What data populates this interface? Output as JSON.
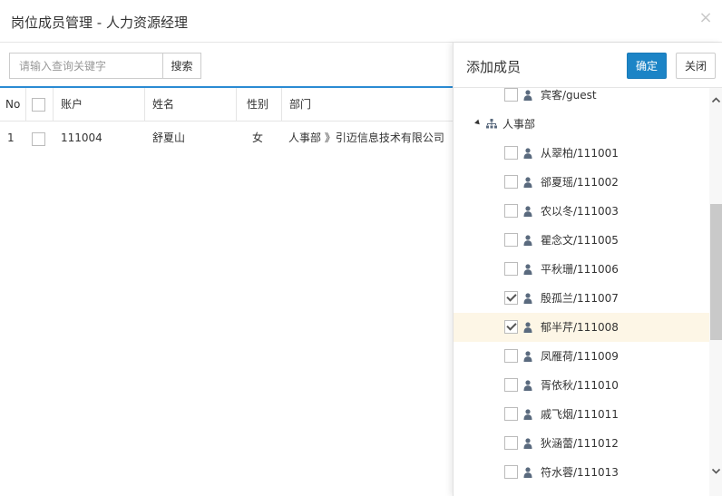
{
  "dialog": {
    "title": "岗位成员管理 - 人力资源经理",
    "close_glyph": "×"
  },
  "search": {
    "placeholder": "请输入查询关键字",
    "button_label": "搜索"
  },
  "table": {
    "columns": [
      "No",
      "",
      "账户",
      "姓名",
      "性别",
      "部门"
    ],
    "rows": [
      {
        "no": "1",
        "checked": false,
        "account": "111004",
        "name": "舒夏山",
        "gender": "女",
        "department": "人事部 》引迈信息技术有限公司"
      }
    ]
  },
  "add_panel": {
    "title": "添加成员",
    "confirm_label": "确定",
    "close_label": "关闭",
    "tree": [
      {
        "type": "user",
        "label": "宾客/guest",
        "checked": false
      },
      {
        "type": "dept",
        "label": "人事部",
        "expanded": true
      },
      {
        "type": "user",
        "label": "从翠柏/111001",
        "checked": false
      },
      {
        "type": "user",
        "label": "郤夏瑶/111002",
        "checked": false
      },
      {
        "type": "user",
        "label": "农以冬/111003",
        "checked": false
      },
      {
        "type": "user",
        "label": "瞿念文/111005",
        "checked": false
      },
      {
        "type": "user",
        "label": "平秋珊/111006",
        "checked": false
      },
      {
        "type": "user",
        "label": "殷孤兰/111007",
        "checked": true
      },
      {
        "type": "user",
        "label": "郁半芹/111008",
        "checked": true,
        "highlighted": true
      },
      {
        "type": "user",
        "label": "凤雁荷/111009",
        "checked": false
      },
      {
        "type": "user",
        "label": "胥依秋/111010",
        "checked": false
      },
      {
        "type": "user",
        "label": "戚飞烟/111011",
        "checked": false
      },
      {
        "type": "user",
        "label": "狄涵蕾/111012",
        "checked": false
      },
      {
        "type": "user",
        "label": "符水蓉/111013",
        "checked": false
      }
    ]
  },
  "colors": {
    "accent": "#1c84c6",
    "table_header_line": "#2a8bd3",
    "highlight_row": "#fdf6e6",
    "icon": "#5a6a7e"
  },
  "icons": {
    "close": "close-icon",
    "user": "user-icon",
    "department": "org-icon",
    "expand": "caret-down-icon",
    "scroll_up": "chevron-up-icon",
    "scroll_down": "chevron-down-icon"
  }
}
